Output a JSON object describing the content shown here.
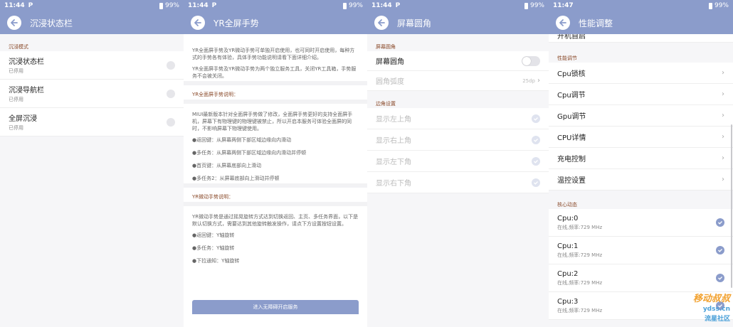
{
  "status": [
    {
      "time": "11:44",
      "p": "P",
      "battery": "99%"
    },
    {
      "time": "11:44",
      "p": "P",
      "battery": "99%"
    },
    {
      "time": "11:44",
      "p": "P",
      "battery": "99%"
    },
    {
      "time": "11:47",
      "p": "",
      "battery": "99%"
    }
  ],
  "colors": {
    "accent": "#8b9ccb",
    "section": "#8a4a2a",
    "watermark": "#f2a12e"
  },
  "icons": {
    "back": "back-arrow-icon",
    "check": "check-circle-icon",
    "chevron": "chevron-right-icon"
  },
  "panel1": {
    "title": "沉浸状态栏",
    "section": "沉浸模式",
    "items": [
      {
        "label": "沉浸状态栏",
        "sub": "已停用"
      },
      {
        "label": "沉浸导航栏",
        "sub": "已停用"
      },
      {
        "label": "全屏沉浸",
        "sub": "已停用"
      }
    ]
  },
  "panel2": {
    "title": "YR全屏手势",
    "intro1": "YR全面屏手势及YR微动手势可单独开启使用，也可同时开启使用，每种方式的手势各有体验，具体手势功能说明请看下面详细介绍。",
    "intro2": "YR全面屏手势及YR微动手势为两个独立服务工具，关闭YR工具箱，手势服务不会被关闭。",
    "sec1": "YR全面屏手势说明：",
    "desc1": "MIUI最新版本针对全面屏手势做了修改，全面屏手势更好的支持全面屏手机，屏幕下有物理键的物理键被禁止，所以开启本服务可体验全面屏的同时，不影响屏幕下物理键使用。",
    "bullets1": [
      "●返回键：从屏幕两侧下部区域边缘向内滑动",
      "●多任务：从屏幕两侧下部区域边缘向内滑动并停顿",
      "●首页键：从屏幕底部向上滑动",
      "●多任务2：从屏幕底部向上滑动并停顿"
    ],
    "sec2": "YR微动手势说明：",
    "desc2": "YR微动手势是通过摇晃旋转方式达到切换返回、主页、多任务界面，以下是默认切换方式，需要达到其他旋转触发操作，请点下方设置按钮设置。",
    "bullets2": [
      "●返回键：Y轴旋转",
      "●多任务：Y轴旋转",
      "●下拉通知：Y轴旋转"
    ],
    "button": "进入无障碍开启服务"
  },
  "panel3": {
    "title": "屏幕圆角",
    "section1": "屏幕圆角",
    "toggle_label": "屏幕圆角",
    "radius_label": "圆角弧度",
    "radius_value": "25dp",
    "section2": "边角设置",
    "corners": [
      "显示左上角",
      "显示右上角",
      "显示左下角",
      "显示右下角"
    ]
  },
  "panel4": {
    "title": "性能调整",
    "top_cut": "开机自启",
    "section1": "性能调节",
    "items": [
      "Cpu锁核",
      "Cpu调节",
      "Gpu调节",
      "CPU详情",
      "充电控制",
      "温控设置"
    ],
    "section2": "核心动态",
    "cores": [
      {
        "label": "Cpu:0",
        "sub": "在线,频率:729 MHz"
      },
      {
        "label": "Cpu:1",
        "sub": "在线,频率:729 MHz"
      },
      {
        "label": "Cpu:2",
        "sub": "在线,频率:729 MHz"
      },
      {
        "label": "Cpu:3",
        "sub": "在线,频率:729 MHz"
      }
    ]
  },
  "watermark": {
    "text": "移动叔叔",
    "site": "ydss.cn",
    "community": "流星社区"
  }
}
